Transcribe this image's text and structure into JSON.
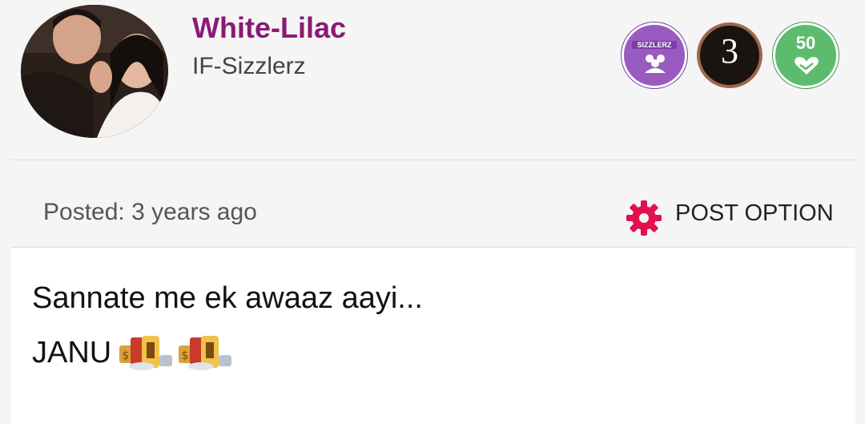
{
  "user": {
    "name": "White-Lilac",
    "group": "IF-Sizzlerz"
  },
  "badges": [
    {
      "icon": "sizzlerz-badge-icon",
      "text": "SIZZLERZ",
      "color": "#9a5bc0"
    },
    {
      "icon": "anniversary-badge-icon",
      "text": "3",
      "color": "#1a1410"
    },
    {
      "icon": "fifty-badge-icon",
      "text": "50",
      "color": "#5dbb6d"
    }
  ],
  "post": {
    "posted": "Posted: 3 years ago",
    "option_label": "POST OPTION",
    "line1": "Sannate me ek awaaz aayi...",
    "line2": "JANU"
  },
  "colors": {
    "username": "#8b1a76",
    "gear": "#e0114d"
  }
}
